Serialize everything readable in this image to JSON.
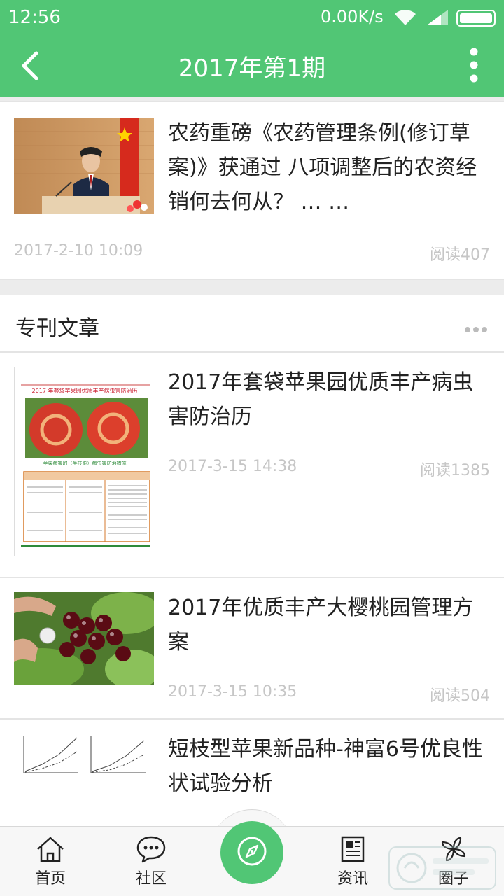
{
  "status_bar": {
    "time": "12:56",
    "net_speed": "0.00K/s",
    "icons": [
      "wifi-icon",
      "signal-icon",
      "battery-icon"
    ]
  },
  "header": {
    "title": "2017年第1期",
    "back_icon": "back-arrow-icon",
    "more_icon": "more-vertical-icon"
  },
  "top_article": {
    "title": "农药重磅《农药管理条例(修订草案)》获通过 八项调整后的农资经销何去何从？ … …",
    "date": "2017-2-10 10:09",
    "reads": "阅读407"
  },
  "section": {
    "title": "专刊文章",
    "more_icon": "more-horizontal-icon"
  },
  "articles": [
    {
      "title": "2017年套袋苹果园优质丰产病虫害防治历",
      "date": "2017-3-15 14:38",
      "reads": "阅读1385",
      "thumb_caption": "2017 年套袋苹果园优质丰产病虫害防治历",
      "thumb_subcaption": "苹果病害的（半技能）病虫害防治措施"
    },
    {
      "title": "2017年优质丰产大樱桃园管理方案",
      "date": "2017-3-15 10:35",
      "reads": "阅读504"
    },
    {
      "title": "短枝型苹果新品种-神富6号优良性状试验分析",
      "date": "",
      "reads": ""
    }
  ],
  "bottom_nav": {
    "items": [
      {
        "label": "首页",
        "icon": "home-icon"
      },
      {
        "label": "社区",
        "icon": "chat-icon"
      },
      {
        "label": "资讯",
        "icon": "newspaper-icon"
      },
      {
        "label": "圈子",
        "icon": "pinwheel-icon"
      }
    ],
    "center_icon": "compass-icon"
  },
  "colors": {
    "brand_green": "#51c675",
    "muted_text": "#c6c6c6",
    "background": "#ececec"
  }
}
